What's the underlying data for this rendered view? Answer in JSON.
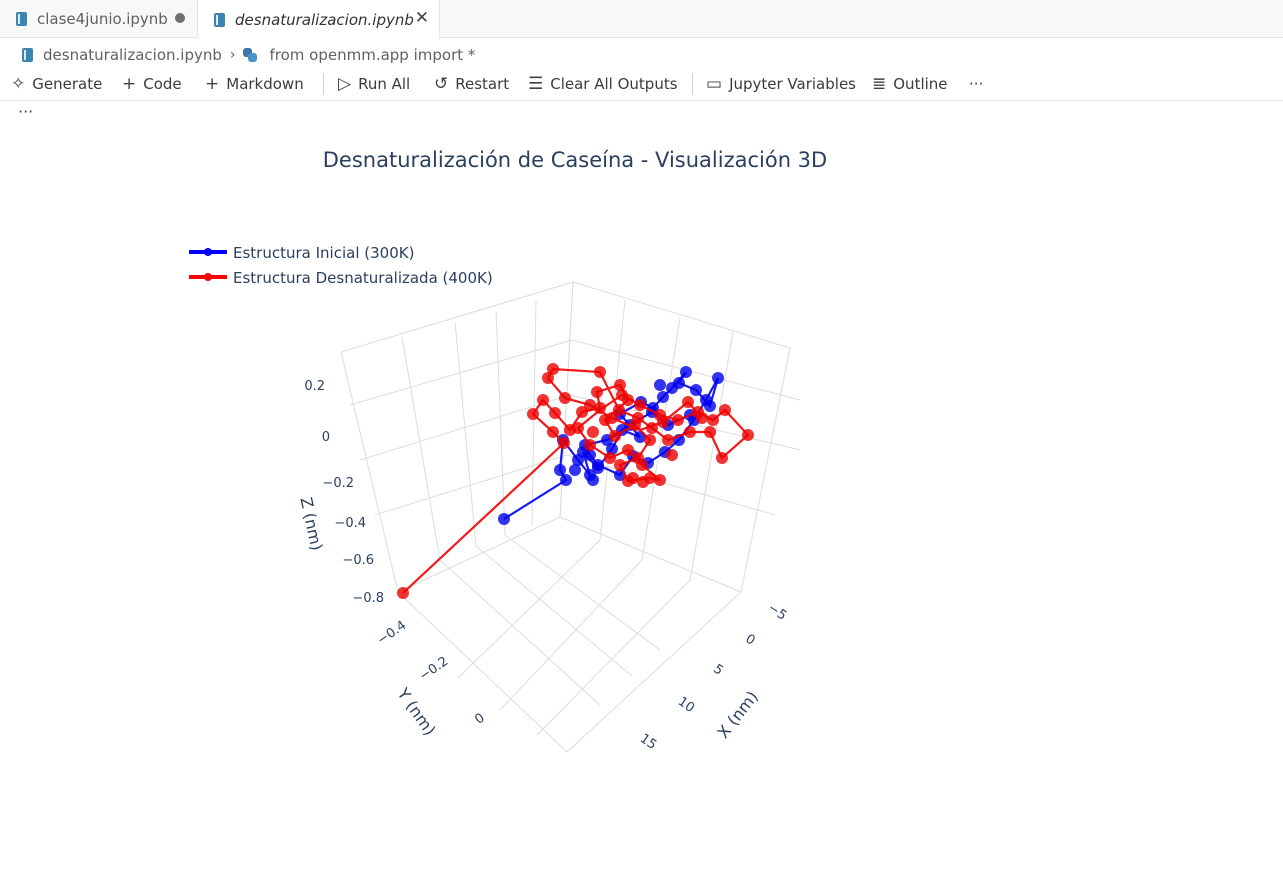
{
  "tabs": [
    {
      "label": "clase4junio.ipynb",
      "modified": true
    },
    {
      "label": "desnaturalizacion.ipynb",
      "active": true
    }
  ],
  "breadcrumb": {
    "file": "desnaturalizacion.ipynb",
    "cell": "from openmm.app import *"
  },
  "toolbar": {
    "generate": "Generate",
    "code": "Code",
    "markdown": "Markdown",
    "run_all": "Run All",
    "restart": "Restart",
    "clear_all_outputs": "Clear All Outputs",
    "jupyter_variables": "Jupyter Variables",
    "outline": "Outline",
    "more": "···"
  },
  "cell_more": "···",
  "chart_data": {
    "type": "scatter3d",
    "title": "Desnaturalización de Caseína - Visualización 3D",
    "xlabel": "X (nm)",
    "ylabel": "Y (nm)",
    "zlabel": "Z (nm)",
    "x_ticks": [
      "−5",
      "0",
      "5",
      "10",
      "15"
    ],
    "y_ticks": [
      "−0.4",
      "−0.2",
      "0"
    ],
    "z_ticks": [
      "0.2",
      "0",
      "−0.2",
      "−0.4",
      "−0.6",
      "−0.8"
    ],
    "legend_position": "top-left",
    "series": [
      {
        "name": "Estructura Inicial (300K)",
        "color": "#0000ff",
        "mode": "lines+markers"
      },
      {
        "name": "Estructura Desnaturalizada (400K)",
        "color": "#ff0000",
        "mode": "lines+markers"
      }
    ]
  }
}
